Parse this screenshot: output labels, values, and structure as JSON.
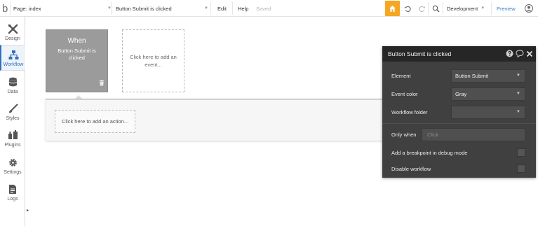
{
  "topbar": {
    "logo": "b",
    "page_label": "Page: index",
    "event_selector": "Button Submit is clicked",
    "menu_edit": "Edit",
    "menu_help": "Help",
    "save_status": "Saved",
    "version_label": "Development",
    "preview_label": "Preview"
  },
  "sidebar": {
    "items": [
      {
        "label": "Design",
        "icon": "design-icon"
      },
      {
        "label": "Workflow",
        "icon": "workflow-icon",
        "active": true
      },
      {
        "label": "Data",
        "icon": "data-icon"
      },
      {
        "label": "Styles",
        "icon": "styles-icon"
      },
      {
        "label": "Plugins",
        "icon": "plugins-icon"
      },
      {
        "label": "Settings",
        "icon": "settings-icon"
      },
      {
        "label": "Logs",
        "icon": "logs-icon"
      }
    ],
    "expand_glyph": "▸"
  },
  "canvas": {
    "when_title": "When",
    "when_event": "Button Submit is clicked",
    "add_event_text": "Click here to add an event...",
    "add_action_text": "Click here to add an action..."
  },
  "popup": {
    "title": "Button Submit is clicked",
    "element_label": "Element",
    "element_value": "Button Submit",
    "event_color_label": "Event color",
    "event_color_value": "Gray",
    "workflow_folder_label": "Workflow folder",
    "workflow_folder_value": "",
    "only_when_label": "Only when",
    "only_when_placeholder": "Click",
    "breakpoint_label": "Add a breakpoint in debug mode",
    "breakpoint_checked": false,
    "disable_label": "Disable workflow",
    "disable_checked": false
  },
  "colors": {
    "accent": "#f6a623",
    "active_blue": "#2f6fbf",
    "popup_bg": "#404040",
    "popup_header": "#262626",
    "when_card": "#9b9b9b"
  }
}
